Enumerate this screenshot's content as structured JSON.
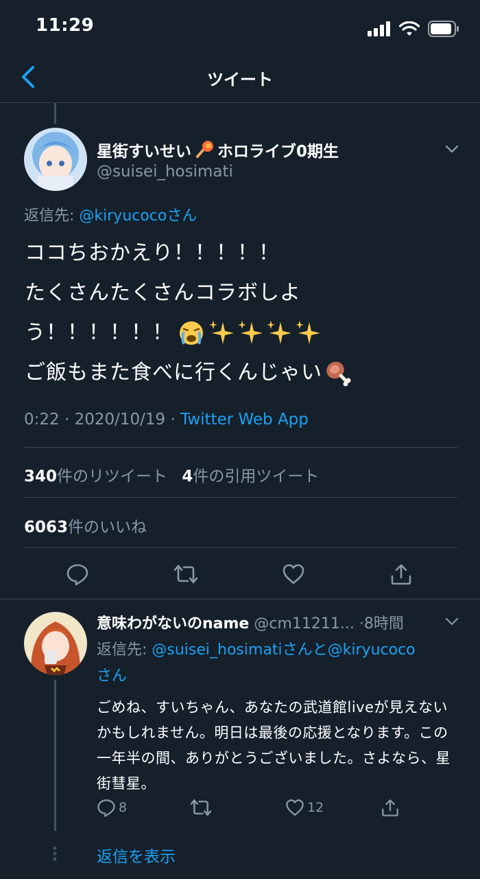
{
  "status_bar": {
    "time": "11:29"
  },
  "header": {
    "title": "ツイート"
  },
  "tweet": {
    "author_name": "星街すいせい",
    "author_name_suffix": "ホロライブ0期生",
    "handle": "@suisei_hosimati",
    "reply_to_prefix": "返信先: ",
    "reply_to_user": "@kiryucocoさん",
    "text_line1": "ココちおかえり！！！！！",
    "text_line2": "たくさんたくさんコラボしよ",
    "text_line3": "う！！！！！！",
    "text_line4": "ご飯もまた食べに行くんじゃい",
    "time": "0:22 · 2020/10/19 · ",
    "source": "Twitter Web App",
    "retweet_count": "340",
    "retweet_label": "件のリツイート",
    "quote_count": "4",
    "quote_label": "件の引用ツイート",
    "like_count": "6063",
    "like_label": "件のいいね"
  },
  "reply": {
    "author_name": "意味わがないのname",
    "handle": "@cm11211...",
    "time": "·8時間",
    "reply_to_prefix": "返信先: ",
    "reply_to_users": "@suisei_hosimatiさんと@kiryucoco",
    "reply_to_suffix": "さん",
    "text": "ごめね、すいちゃん、あなたの武道館liveが見えないかもしれません。明日は最後の応援となります。この一年半の間、ありがとうございました。さよなら、星街彗星。",
    "reply_count": "8",
    "like_count": "12"
  },
  "show_replies": "返信を表示",
  "colors": {
    "background": "#15202b",
    "accent": "#1da1f2",
    "muted": "#8899a6",
    "divider": "#38444d"
  }
}
